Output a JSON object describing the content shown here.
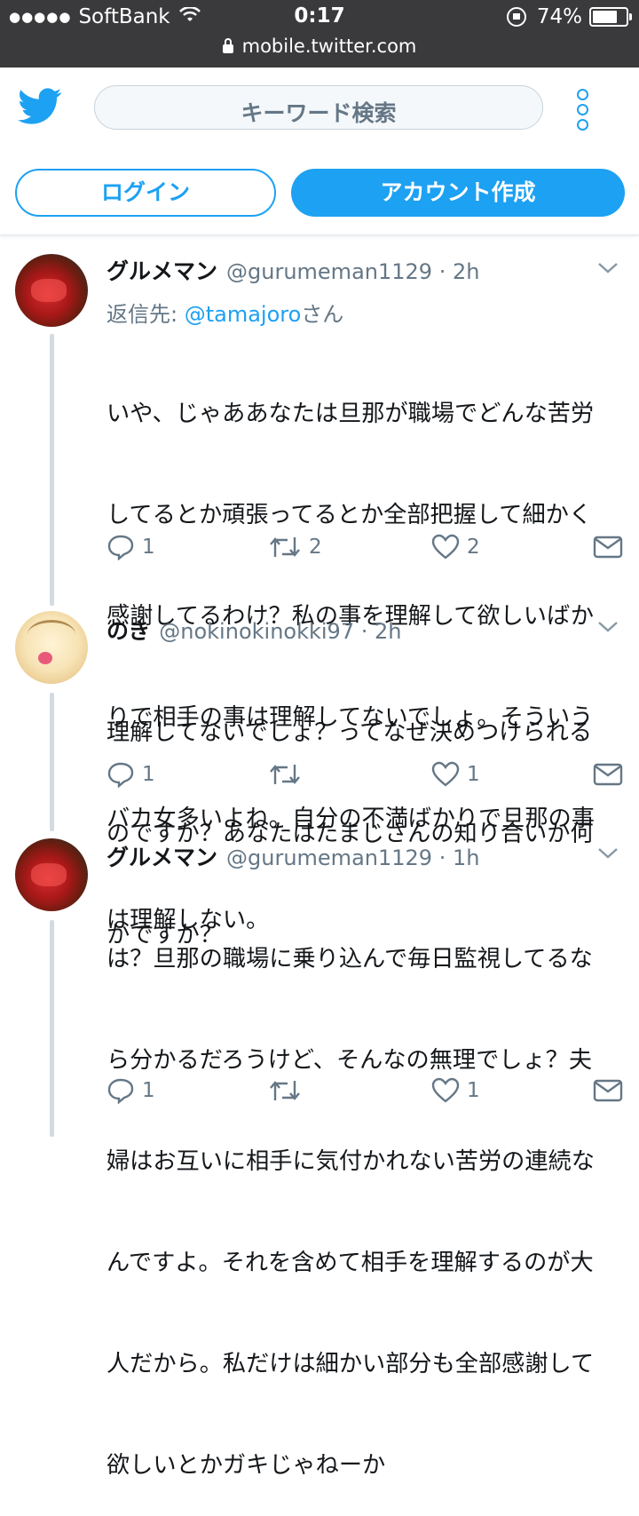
{
  "status_bar": {
    "carrier": "SoftBank",
    "time": "0:17",
    "battery": "74%",
    "battery_level": 0.74,
    "url": "mobile.twitter.com"
  },
  "header": {
    "search_placeholder": "キーワード検索",
    "login_label": "ログイン",
    "signup_label": "アカウント作成"
  },
  "tweets": [
    {
      "name": "グルメマン",
      "handle": "@gurumeman1129 · 2h",
      "reply_prefix": "返信先: ",
      "reply_handle": "@tamajoro",
      "reply_suffix": "さん",
      "lines": [
        "いや、じゃああなたは旦那が職場でどんな苦労",
        "してるとか頑張ってるとか全部把握して細かく",
        "感謝してるわけ？私の事を理解して欲しいばか",
        "りで相手の事は理解してないでしょ。そういう",
        "バカ女多いよね。自分の不満ばかりで旦那の事",
        "は理解しない。"
      ],
      "replies": "1",
      "retweets": "2",
      "likes": "2"
    },
    {
      "name": "のき",
      "handle": "@nokinokinokki97 · 2h",
      "lines": [
        "理解してないでしょ？ってなぜ決めつけられる",
        "のですか？あなたはたまじさんの知り合いか何",
        "かですか？"
      ],
      "replies": "1",
      "retweets": "",
      "likes": "1"
    },
    {
      "name": "グルメマン",
      "handle": "@gurumeman1129 · 1h",
      "lines": [
        "は？旦那の職場に乗り込んで毎日監視してるな",
        "ら分かるだろうけど、そんなの無理でしょ？夫",
        "婦はお互いに相手に気付かれない苦労の連続な",
        "んですよ。それを含めて相手を理解するのが大",
        "人だから。私だけは細かい部分も全部感謝して",
        "欲しいとかガキじゃねーか"
      ],
      "replies": "1",
      "retweets": "",
      "likes": "1"
    }
  ]
}
